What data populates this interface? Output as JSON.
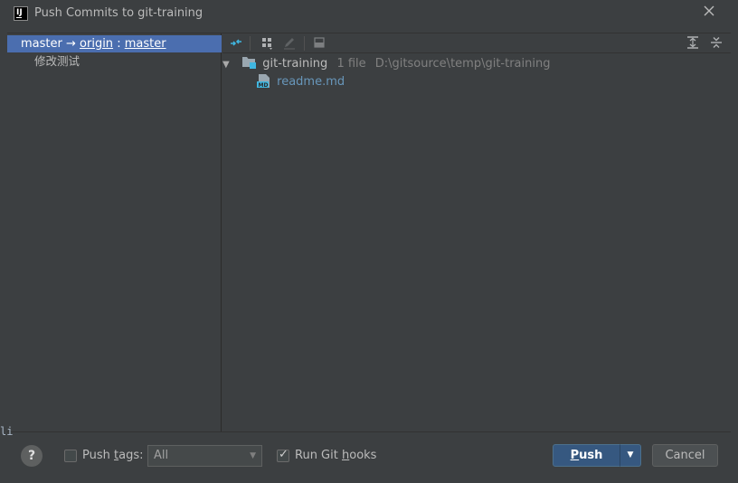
{
  "window": {
    "title": "Push Commits to git-training",
    "app_icon_letters": "IJ"
  },
  "left": {
    "branch": {
      "local": "master",
      "arrow": "→",
      "remote": "origin",
      "separator": ":",
      "remote_branch": "master"
    },
    "commits": [
      "修改测试"
    ]
  },
  "tree": {
    "repo": {
      "name": "git-training",
      "file_count": "1 file",
      "path": "D:\\gitsource\\temp\\git-training"
    },
    "files": [
      {
        "name": "readme.md",
        "icon": "markdown-file-icon"
      }
    ]
  },
  "footer": {
    "help": "?",
    "push_tags": {
      "label_pre": "Push ",
      "label_u": "t",
      "label_post": "ags:",
      "checked": false
    },
    "tags_select": {
      "value": "All",
      "options": [
        "All"
      ]
    },
    "run_hooks": {
      "label_pre": "Run Git ",
      "label_u": "h",
      "label_post": "ooks",
      "checked": true
    },
    "push_button": {
      "u": "P",
      "rest": "ush"
    },
    "cancel_button": "Cancel"
  },
  "colors": {
    "selection": "#4b6eaf",
    "dialog_bg": "#3c3f41",
    "primary_button": "#365880",
    "file_link": "#6897bb",
    "accent_icon": "#40b6e0"
  },
  "background_fragment": "li"
}
